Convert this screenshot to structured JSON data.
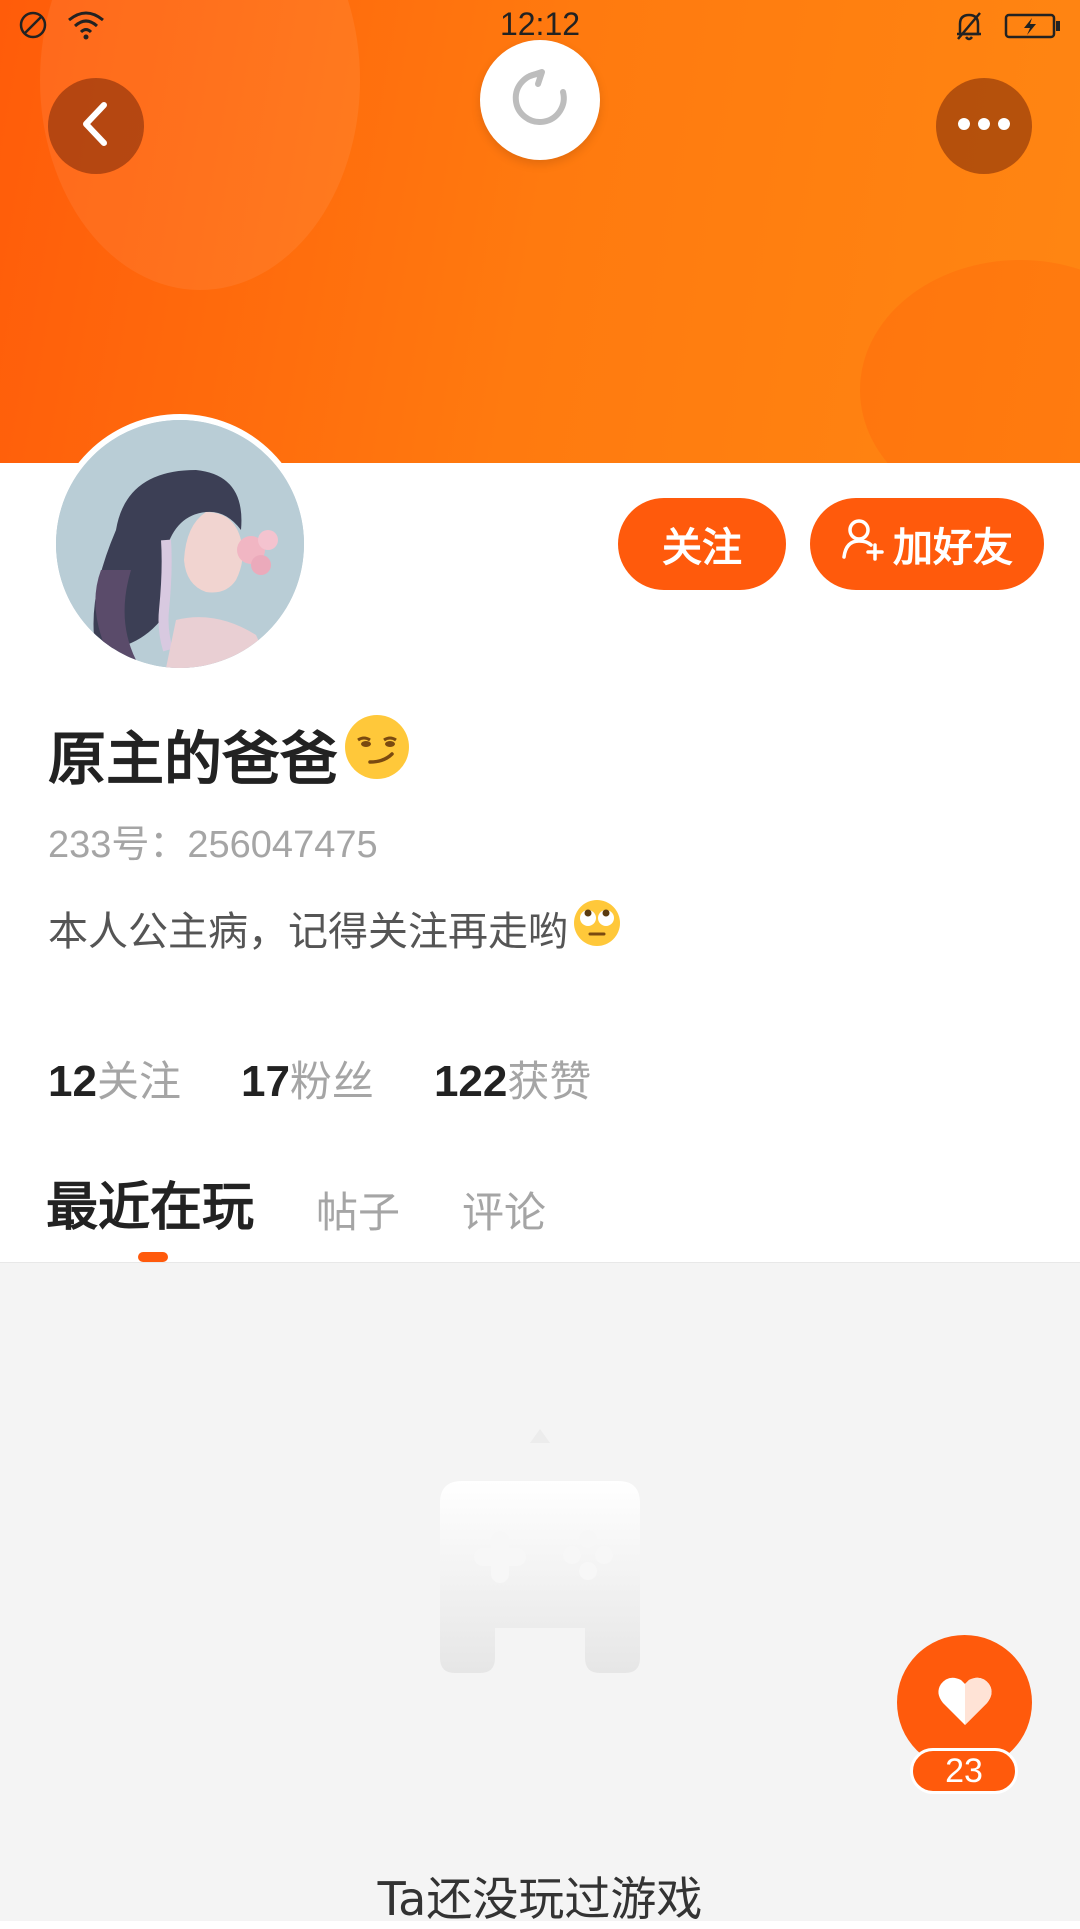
{
  "status_bar": {
    "time": "12:12",
    "icons": [
      "do-not-disturb-icon",
      "wifi-icon",
      "bell-muted-icon",
      "battery-charging-icon"
    ]
  },
  "header": {
    "back_icon": "chevron-left-icon",
    "refresh_icon": "refresh-icon",
    "more_icon": "more-dots-icon"
  },
  "actions": {
    "follow_label": "关注",
    "add_friend_label": "加好友",
    "add_friend_icon": "add-user-icon"
  },
  "profile": {
    "name": "原主的爸爸",
    "name_emoji": "smirk-emoji",
    "id_text": "233号：256047475",
    "bio": "本人公主病，记得关注再走哟",
    "bio_emoji": "eye-roll-emoji"
  },
  "stats": [
    {
      "value": "12",
      "label": "关注"
    },
    {
      "value": "17",
      "label": "粉丝"
    },
    {
      "value": "122",
      "label": "获赞"
    }
  ],
  "tabs": [
    {
      "label": "最近在玩",
      "active": true
    },
    {
      "label": "帖子",
      "active": false
    },
    {
      "label": "评论",
      "active": false
    }
  ],
  "content": {
    "empty_text": "Ta还没玩过游戏",
    "empty_icon": "gamepad-icon"
  },
  "like_fab": {
    "icon": "heart-icon",
    "count": "23"
  },
  "colors": {
    "accent": "#ff5a0c",
    "banner_start": "#ff5c0a",
    "banner_end": "#ff8612"
  }
}
